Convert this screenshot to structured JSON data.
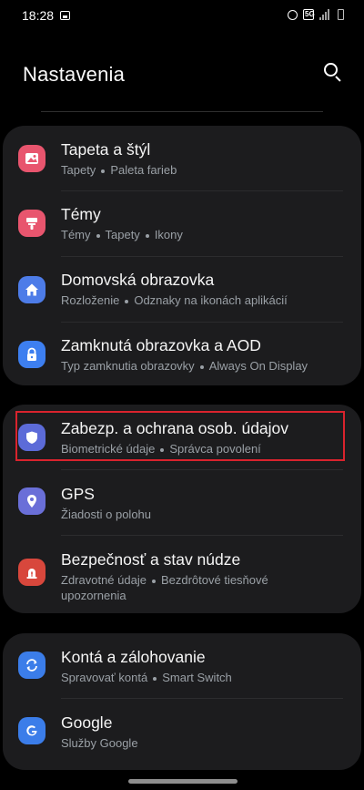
{
  "status": {
    "time": "18:28",
    "network": "5G"
  },
  "header": {
    "title": "Nastavenia"
  },
  "card1": {
    "items": [
      {
        "title": "Tapeta a štýl",
        "sub": [
          "Tapety",
          "Paleta farieb"
        ],
        "icon": "wallpaper-icon",
        "color": "#e8556e"
      },
      {
        "title": "Témy",
        "sub": [
          "Témy",
          "Tapety",
          "Ikony"
        ],
        "icon": "themes-icon",
        "color": "#e8556e"
      },
      {
        "title": "Domovská obrazovka",
        "sub": [
          "Rozloženie",
          "Odznaky na ikonách aplikácií"
        ],
        "icon": "home-icon",
        "color": "#4d7ce8"
      },
      {
        "title": "Zamknutá obrazovka a AOD",
        "sub": [
          "Typ zamknutia obrazovky",
          "Always On Display"
        ],
        "icon": "lock-icon",
        "color": "#3d7ff0"
      }
    ]
  },
  "card2": {
    "items": [
      {
        "title": "Zabezp. a ochrana osob. údajov",
        "sub": [
          "Biometrické údaje",
          "Správca povolení"
        ],
        "icon": "shield-icon",
        "color": "#5c6bd8"
      },
      {
        "title": "GPS",
        "sub": [
          "Žiadosti o polohu"
        ],
        "icon": "location-pin-icon",
        "color": "#6a6fd8"
      },
      {
        "title": "Bezpečnosť a stav núdze",
        "sub": [
          "Zdravotné údaje",
          "Bezdrôtové tiesňové"
        ],
        "sub2": "upozornenia",
        "icon": "emergency-icon",
        "color": "#d8473c"
      }
    ]
  },
  "card3": {
    "items": [
      {
        "title": "Kontá a zálohovanie",
        "sub": [
          "Spravovať kontá",
          "Smart Switch"
        ],
        "icon": "sync-icon",
        "color": "#3b7de9"
      },
      {
        "title": "Google",
        "sub": [
          "Služby Google"
        ],
        "icon": "google-icon",
        "color": "#3b7de9"
      }
    ]
  }
}
